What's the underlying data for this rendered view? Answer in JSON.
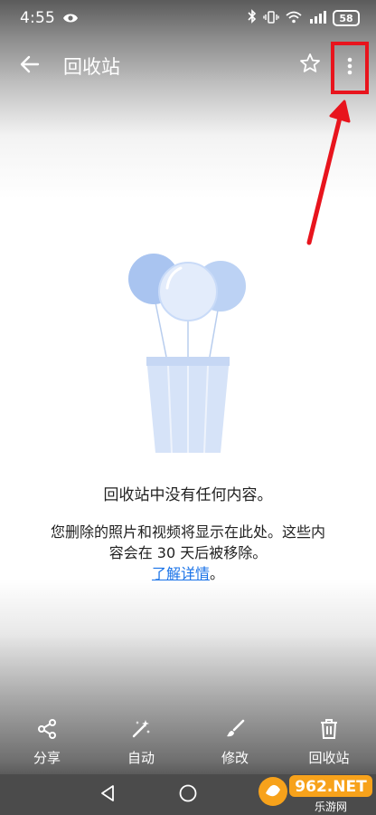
{
  "status_bar": {
    "time": "4:55",
    "battery": "58"
  },
  "app_bar": {
    "title": "回收站"
  },
  "empty_state": {
    "title": "回收站中没有任何内容。",
    "description": "您删除的照片和视频将显示在此处。这些内容会在 30 天后被移除。",
    "learn_more": "了解详情",
    "period": "。"
  },
  "bottom_actions": [
    {
      "label": "分享",
      "icon": "share-icon"
    },
    {
      "label": "自动",
      "icon": "magic-wand-icon"
    },
    {
      "label": "修改",
      "icon": "brush-icon"
    },
    {
      "label": "回收站",
      "icon": "trash-icon"
    }
  ],
  "watermark": {
    "text": "962.NET",
    "subtext": "乐游网"
  },
  "colors": {
    "annotation": "#e8141d",
    "link": "#1a73e8",
    "balloon_light": "#c9dbf8",
    "balloon_dark": "#a9c4f0",
    "cup": "#d6e3f8"
  }
}
